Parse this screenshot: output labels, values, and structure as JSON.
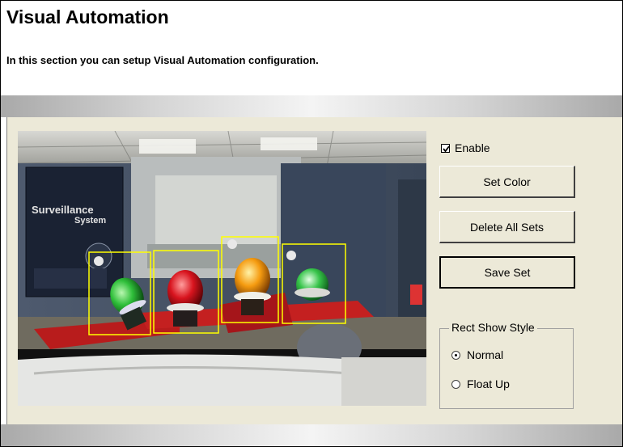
{
  "page": {
    "title": "Visual Automation",
    "subtitle": "In this section you can setup Visual Automation configuration."
  },
  "video": {
    "poster_text_line1": "Surveillance",
    "poster_text_line2": "System"
  },
  "controls": {
    "enable_label": "Enable",
    "enable_checked": true,
    "set_color_label": "Set Color",
    "delete_all_sets_label": "Delete All Sets",
    "save_set_label": "Save Set"
  },
  "rect_show_style": {
    "title": "Rect Show Style",
    "options": [
      {
        "label": "Normal",
        "selected": true
      },
      {
        "label": "Float Up",
        "selected": false
      }
    ]
  },
  "colors": {
    "selection_rect": "#ffff00",
    "panel_bg": "#ece9d8"
  }
}
